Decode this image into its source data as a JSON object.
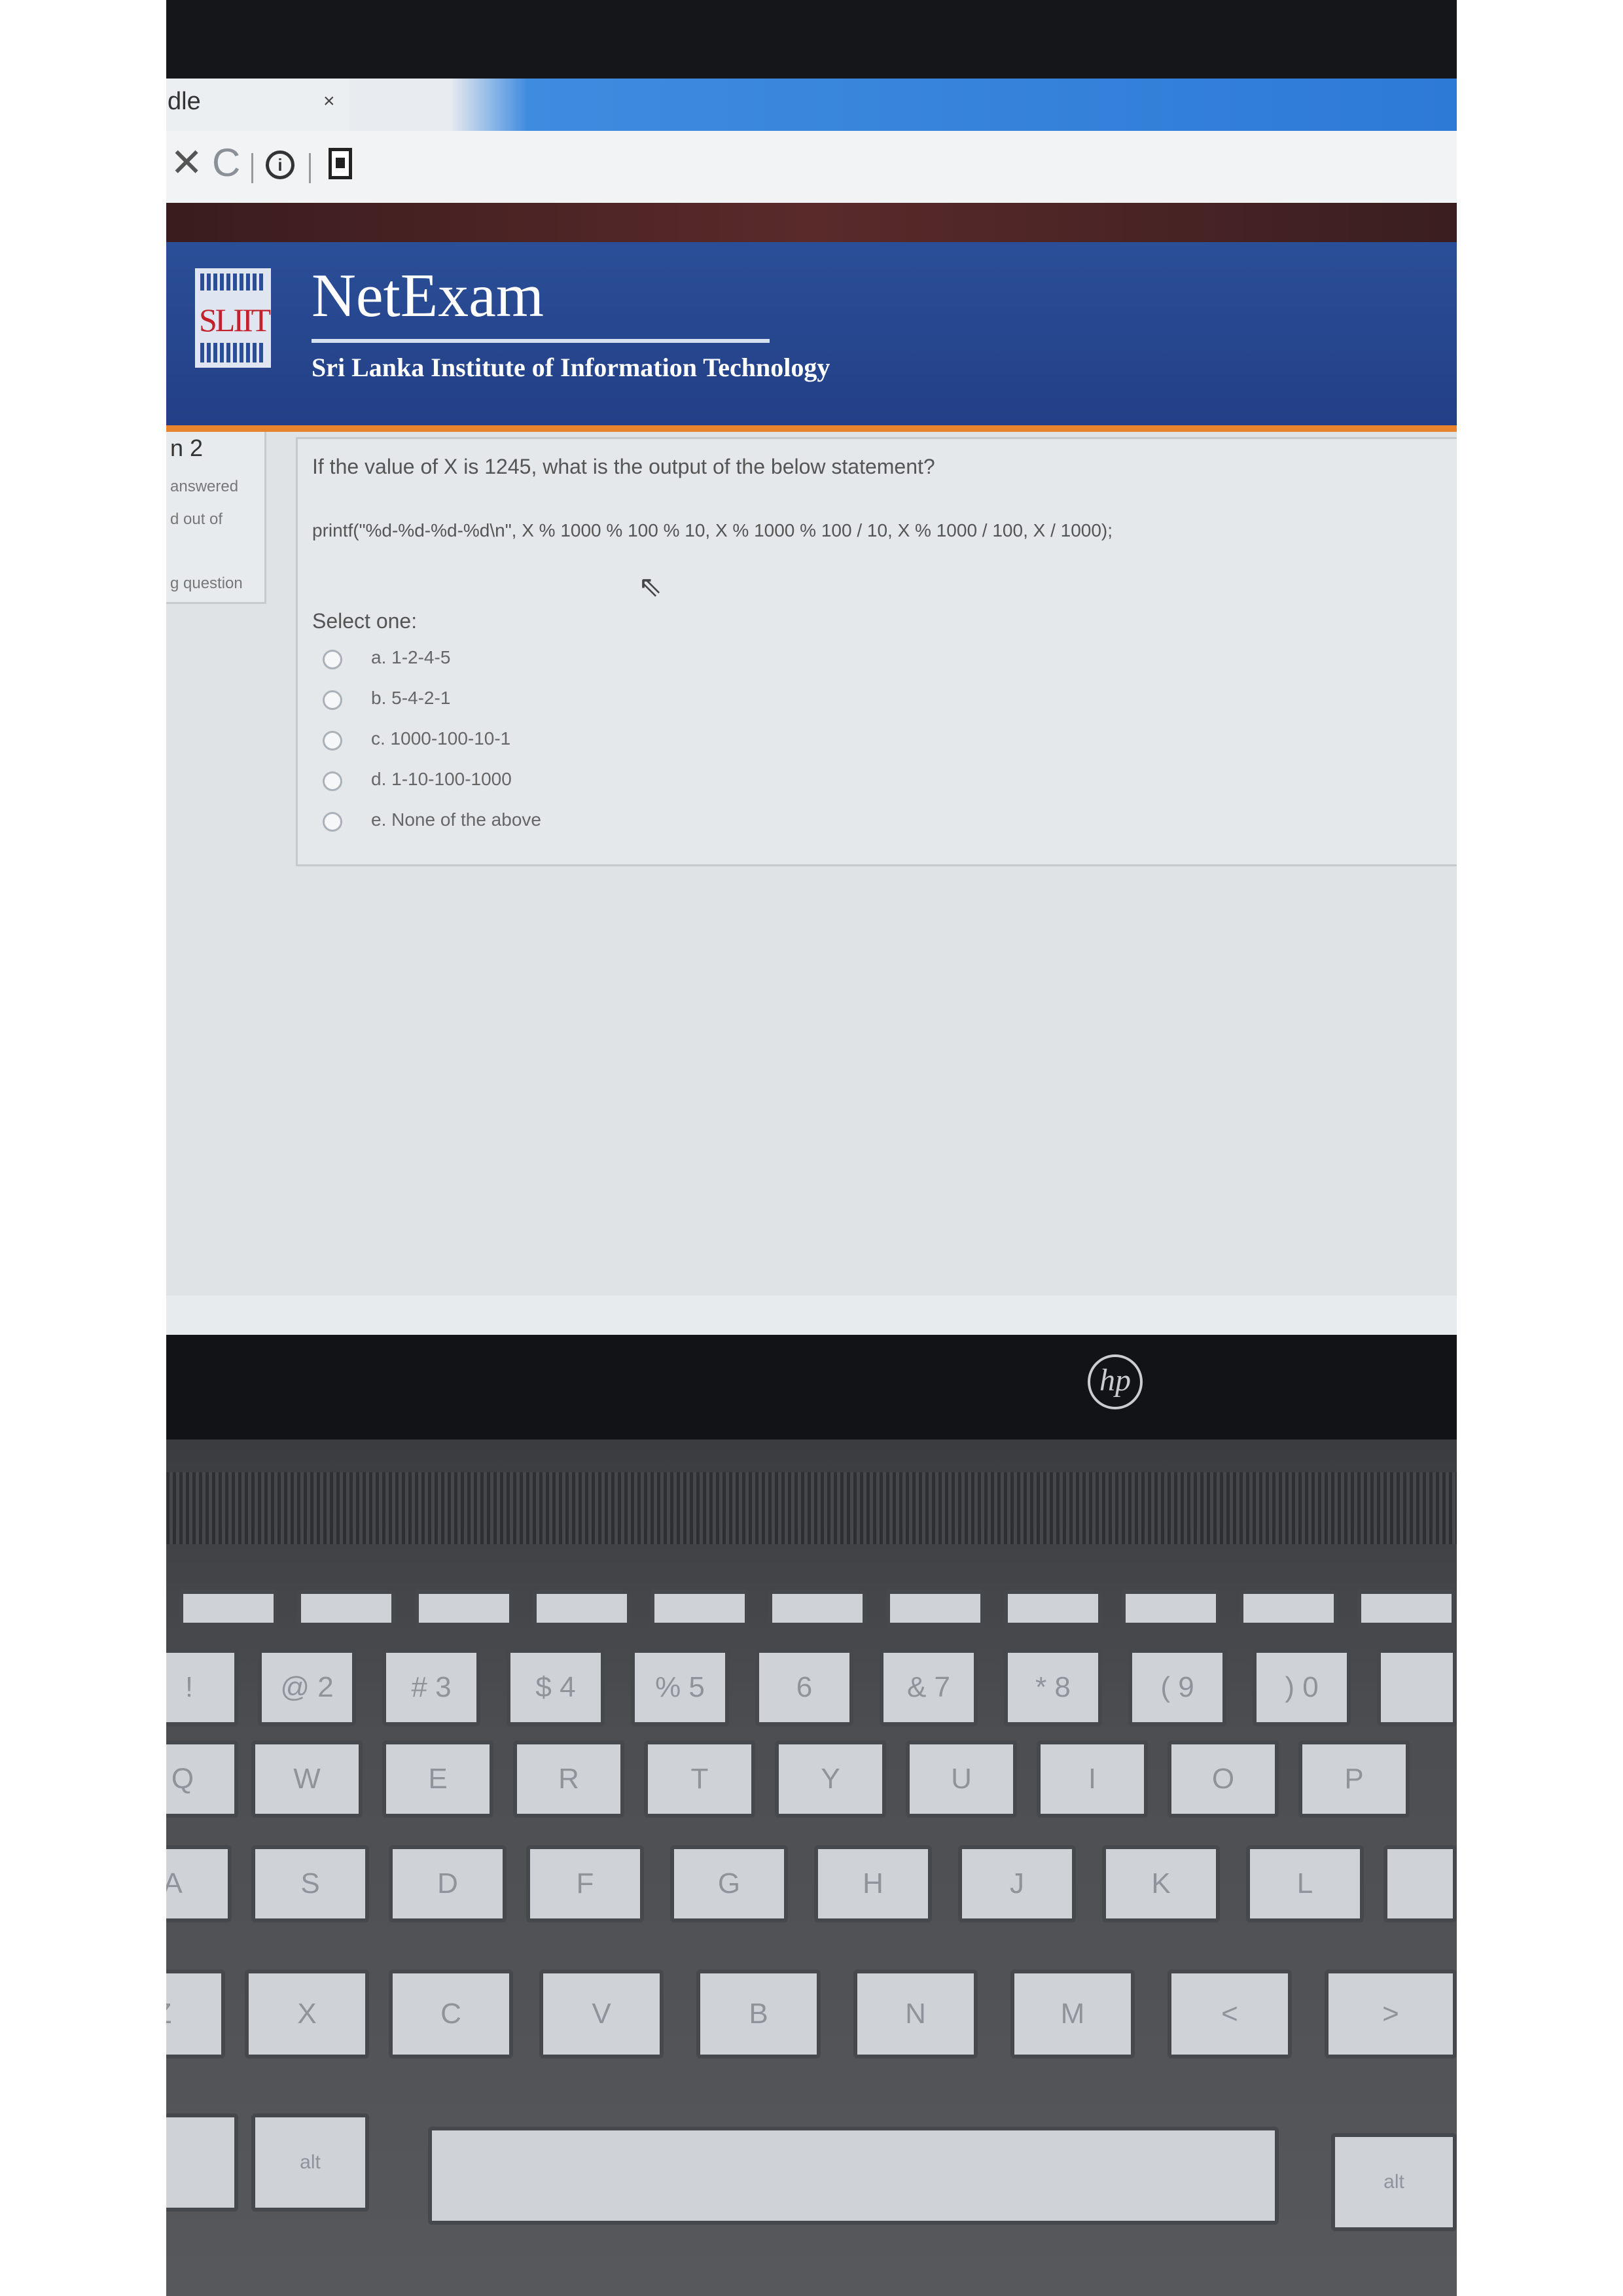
{
  "browser": {
    "tab_title": "dle",
    "tab_close": "×",
    "stop_glyph": "✕",
    "reload_glyph": "C",
    "info_glyph": "i"
  },
  "header": {
    "logo_text": "SLIIT",
    "app_title": "NetExam",
    "subtitle": "Sri Lanka Institute of Information Technology",
    "accent_color": "#e8832e",
    "banner_color": "#2a4f98"
  },
  "question_nav": {
    "number": "n 2",
    "status": "answered",
    "marks": "d out of",
    "flag": "g question"
  },
  "question": {
    "prompt": "If the value of X is 1245, what is the output of the below statement?",
    "code": "printf(\"%d-%d-%d-%d\\n\", X % 1000 % 100 % 10, X % 1000 % 100 / 10, X % 1000 / 100, X / 1000);",
    "select_label": "Select one:",
    "options": [
      {
        "label": "a. 1-2-4-5"
      },
      {
        "label": "b. 5-4-2-1"
      },
      {
        "label": "c. 1000-100-10-1"
      },
      {
        "label": "d. 1-10-100-1000"
      },
      {
        "label": "e. None of the above"
      }
    ]
  },
  "laptop": {
    "brand": "hp",
    "keys_row1": [
      "!",
      "@ 2",
      "# 3",
      "$ 4",
      "% 5",
      "6",
      "& 7",
      "* 8",
      "( 9",
      ") 0"
    ],
    "keys_row2": [
      "Q",
      "W",
      "E",
      "R",
      "T",
      "Y",
      "U",
      "I",
      "O",
      "P"
    ],
    "keys_row3": [
      "A",
      "S",
      "D",
      "F",
      "G",
      "H",
      "J",
      "K",
      "L"
    ],
    "keys_row4": [
      "Z",
      "X",
      "C",
      "V",
      "B",
      "N",
      "M",
      "<",
      ">"
    ],
    "keys_row5": [
      "alt",
      "",
      "alt"
    ]
  }
}
